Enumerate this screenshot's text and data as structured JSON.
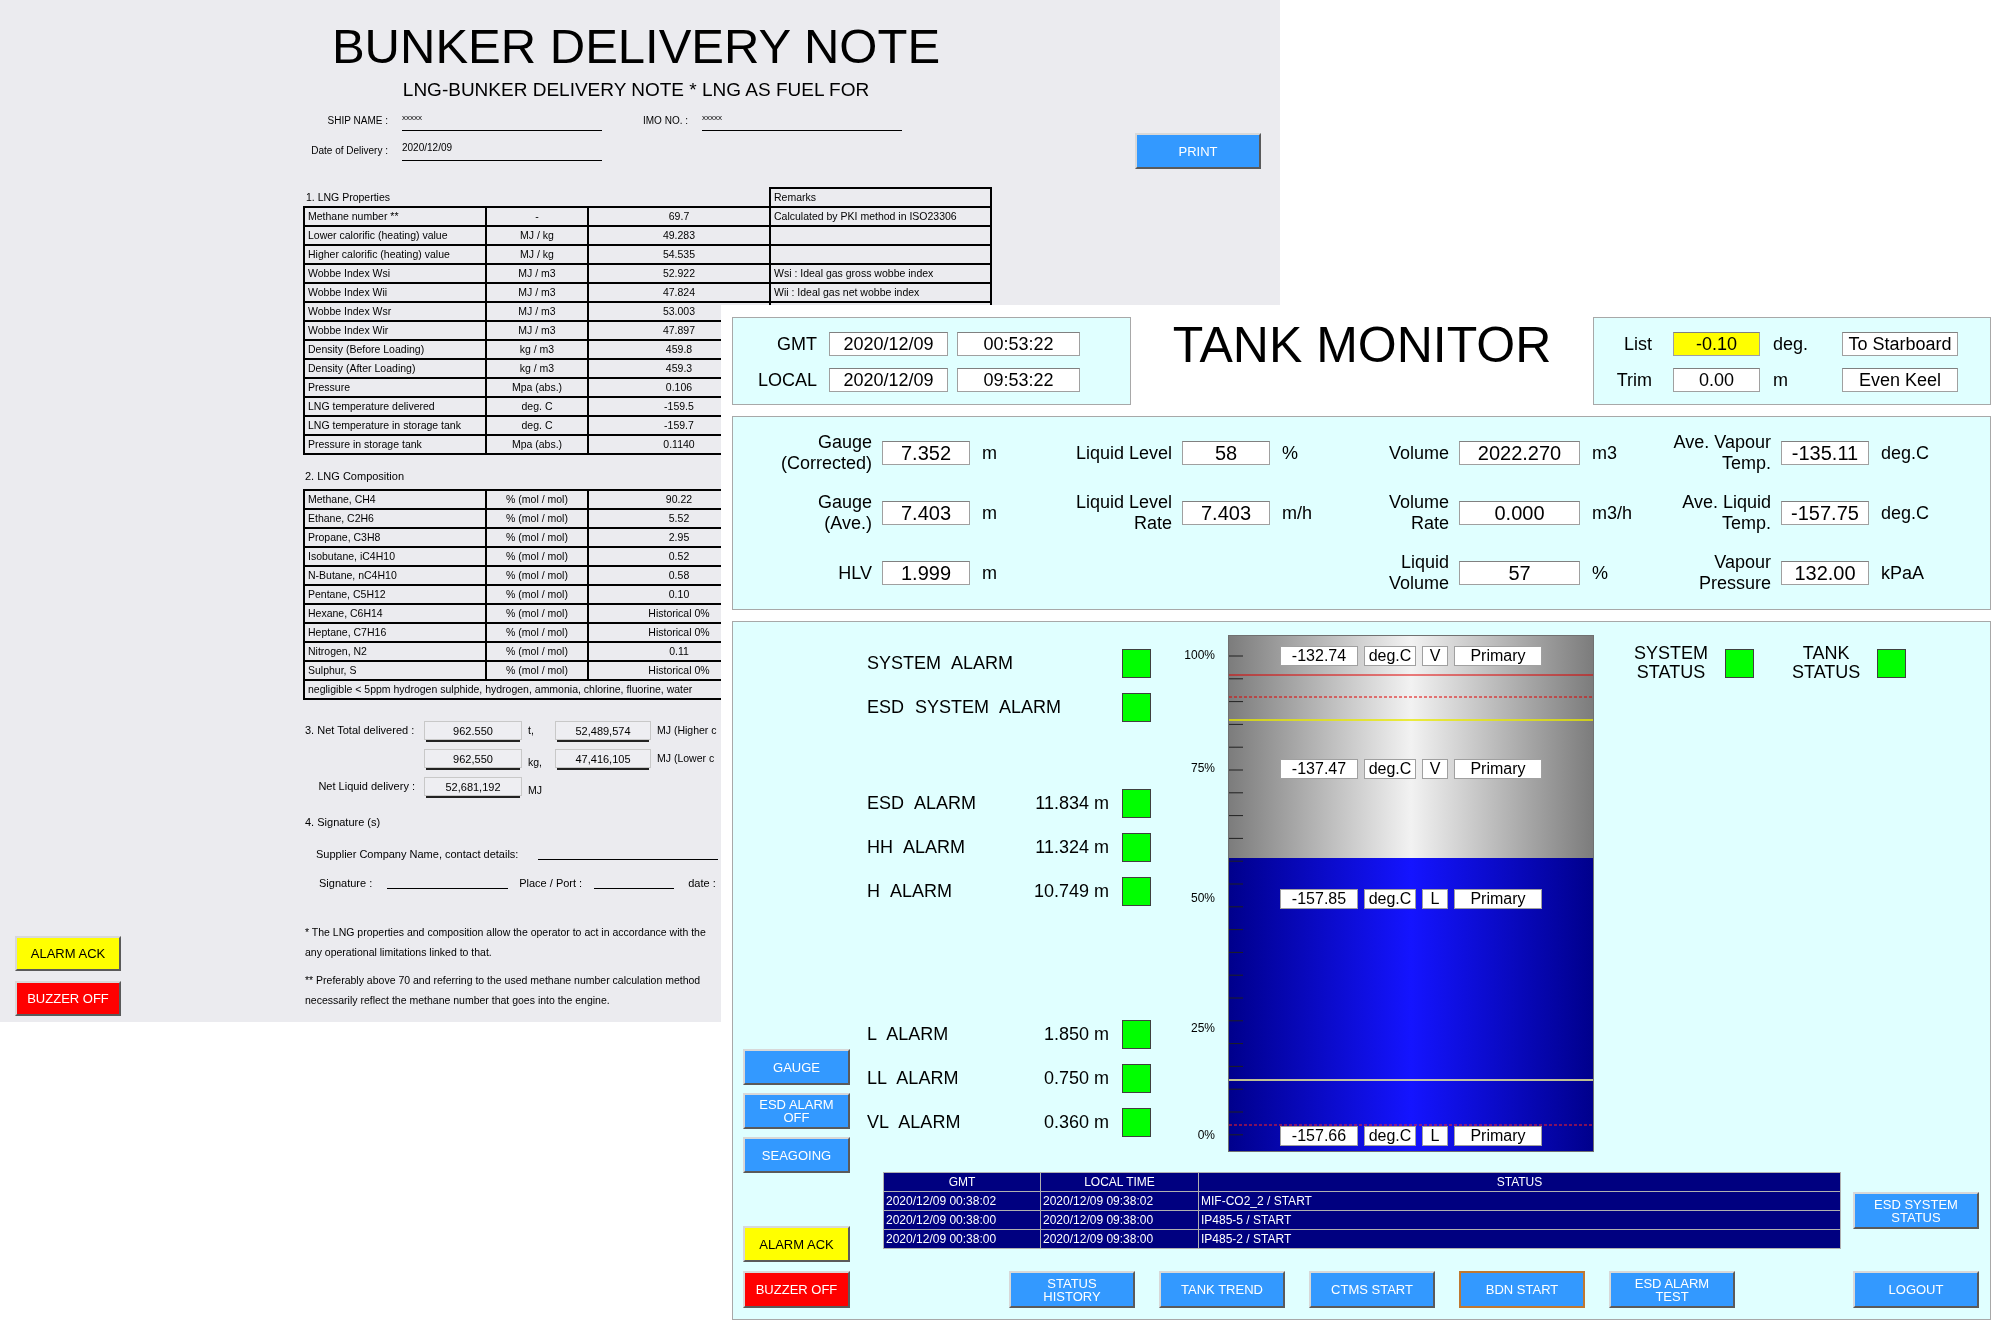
{
  "delivery_note": {
    "title": "BUNKER DELIVERY NOTE",
    "subtitle": "LNG-BUNKER DELIVERY NOTE * LNG AS FUEL FOR",
    "ship_name": {
      "label": "SHIP NAME :",
      "value": "xxxxx"
    },
    "imo_no": {
      "label": "IMO NO. :",
      "value": "xxxxx"
    },
    "date_of_delivery": {
      "label": "Date of Delivery :",
      "value": "2020/12/09"
    },
    "print_button": "PRINT",
    "properties": {
      "title": "1. LNG Properties",
      "remarks_header": "Remarks",
      "rows": [
        {
          "name": "Methane number **",
          "unit": "-",
          "value": "69.7",
          "remark": "Calculated by PKI method in ISO23306"
        },
        {
          "name": "Lower calorific (heating) value",
          "unit": "MJ / kg",
          "value": "49.283"
        },
        {
          "name": "Higher calorific (heating) value",
          "unit": "MJ / kg",
          "value": "54.535"
        },
        {
          "name": "Wobbe Index Wsi",
          "unit": "MJ / m3",
          "value": "52.922",
          "remark": "Wsi : Ideal gas gross wobbe index"
        },
        {
          "name": "Wobbe Index Wii",
          "unit": "MJ / m3",
          "value": "47.824",
          "remark": "Wii : Ideal gas net wobbe index"
        },
        {
          "name": "Wobbe Index Wsr",
          "unit": "MJ / m3",
          "value": "53.003"
        },
        {
          "name": "Wobbe Index Wir",
          "unit": "MJ / m3",
          "value": "47.897"
        },
        {
          "name": "Density (Before Loading)",
          "unit": "kg / m3",
          "value": "459.8"
        },
        {
          "name": "Density (After Loading)",
          "unit": "kg / m3",
          "value": "459.3"
        },
        {
          "name": "Pressure",
          "unit": "Mpa (abs.)",
          "value": "0.106"
        },
        {
          "name": "LNG temperature delivered",
          "unit": "deg. C",
          "value": "-159.5"
        },
        {
          "name": "LNG temperature in storage tank",
          "unit": "deg. C",
          "value": "-159.7"
        },
        {
          "name": "Pressure in storage tank",
          "unit": "Mpa (abs.)",
          "value": "0.1140"
        }
      ]
    },
    "composition": {
      "title": "2. LNG Composition",
      "rows": [
        {
          "name": "Methane, CH4",
          "unit": "% (mol / mol)",
          "value": "90.22"
        },
        {
          "name": "Ethane, C2H6",
          "unit": "% (mol / mol)",
          "value": "5.52"
        },
        {
          "name": "Propane, C3H8",
          "unit": "% (mol / mol)",
          "value": "2.95"
        },
        {
          "name": "Isobutane, iC4H10",
          "unit": "% (mol / mol)",
          "value": "0.52"
        },
        {
          "name": "N-Butane, nC4H10",
          "unit": "% (mol / mol)",
          "value": "0.58"
        },
        {
          "name": "Pentane, C5H12",
          "unit": "% (mol / mol)",
          "value": "0.10"
        },
        {
          "name": "Hexane, C6H14",
          "unit": "% (mol / mol)",
          "value": "Historical 0%"
        },
        {
          "name": "Heptane, C7H16",
          "unit": "% (mol / mol)",
          "value": "Historical 0%"
        },
        {
          "name": "Nitrogen, N2",
          "unit": "% (mol / mol)",
          "value": "0.11"
        },
        {
          "name": "Sulphur, S",
          "unit": "% (mol / mol)",
          "value": "Historical 0%"
        }
      ],
      "note": "negligible < 5ppm hydrogen sulphide, hydrogen, ammonia, chlorine, fluorine, water"
    },
    "net_total": {
      "label": "3. Net Total delivered :",
      "rows": [
        {
          "value": "962.550",
          "unit": "t,",
          "energy": "52,489,574",
          "energy_unit": "MJ (Higher c"
        },
        {
          "value": "962,550",
          "unit": "kg,",
          "energy": "47,416,105",
          "energy_unit": "MJ (Lower c"
        }
      ],
      "net_liquid": {
        "label": "Net Liquid delivery :",
        "value": "52,681,192",
        "unit": "MJ"
      }
    },
    "signatures": {
      "title": "4. Signature (s)",
      "supplier_label": "Supplier Company Name, contact details:",
      "signature_label": "Signature :",
      "place_label": "Place / Port :",
      "date_label": "date :"
    },
    "footnotes": [
      "* The LNG properties and composition allow the operator to act in accordance with the",
      "any operational limitations linked to that.",
      "** Preferably above 70 and referring to the used methane number calculation method",
      "necessarily reflect the methane number that goes into the engine."
    ],
    "buttons": [
      {
        "label": "ALARM ACK",
        "kind": "ack"
      },
      {
        "label": "BUZZER OFF",
        "kind": "buzzer"
      }
    ]
  },
  "tank_monitor": {
    "clock": [
      {
        "label": "GMT",
        "date": "2020/12/09",
        "time": "00:53:22"
      },
      {
        "label": "LOCAL",
        "date": "2020/12/09",
        "time": "09:53:22"
      }
    ],
    "title": "TANK MONITOR",
    "attitude": [
      {
        "label": "List",
        "value": "-0.10",
        "highlighted": true,
        "unit": "deg.",
        "status": "To Starboard"
      },
      {
        "label": "Trim",
        "value": "0.00",
        "highlighted": false,
        "unit": "m",
        "status": "Even Keel"
      }
    ],
    "readings": [
      [
        {
          "label": "Gauge\n(Corrected)",
          "value": "7.352",
          "unit": "m"
        },
        {
          "label": "Gauge\n(Ave.)",
          "value": "7.403",
          "unit": "m"
        },
        {
          "label": "HLV",
          "value": "1.999",
          "unit": "m"
        }
      ],
      [
        {
          "label": "Liquid Level",
          "value": "58",
          "unit": "%"
        },
        {
          "label": "Liquid Level\nRate",
          "value": "7.403",
          "unit": "m/h"
        }
      ],
      [
        {
          "label": "Volume",
          "value": "2022.270",
          "unit": "m3"
        },
        {
          "label": "Volume\nRate",
          "value": "0.000",
          "unit": "m3/h"
        },
        {
          "label": "Liquid\nVolume",
          "value": "57",
          "unit": "%"
        }
      ],
      [
        {
          "label": "Ave. Vapour\nTemp.",
          "value": "-135.11",
          "unit": "deg.C"
        },
        {
          "label": "Ave. Liquid\nTemp.",
          "value": "-157.75",
          "unit": "deg.C"
        },
        {
          "label": "Vapour\nPressure",
          "value": "132.00",
          "unit": "kPaA"
        }
      ]
    ],
    "alarm_groups": [
      [
        {
          "label": "SYSTEM ALARM",
          "color": "#00ff00"
        },
        {
          "label": "ESD SYSTEM ALARM",
          "color": "#00ff00"
        }
      ],
      [
        {
          "label": "ESD ALARM",
          "value": "11.834 m",
          "color": "#00ff00"
        },
        {
          "label": "HH ALARM",
          "value": "11.324 m",
          "color": "#00ff00"
        },
        {
          "label": "H ALARM",
          "value": "10.749 m",
          "color": "#00ff00"
        }
      ],
      [
        {
          "label": "L ALARM",
          "value": "1.850 m",
          "color": "#00ff00"
        },
        {
          "label": "LL ALARM",
          "value": "0.750 m",
          "color": "#00ff00"
        },
        {
          "label": "VL ALARM",
          "value": "0.360 m",
          "color": "#00ff00"
        }
      ]
    ],
    "mode_buttons": [
      "GAUGE",
      "ESD ALARM\nOFF",
      "SEAGOING"
    ],
    "tank": {
      "level": 0.58,
      "scale": [
        "100%",
        "75%",
        "50%",
        "25%",
        "0%"
      ],
      "probes": [
        {
          "temp": "-132.74",
          "unit": "deg.C",
          "phase": "V",
          "sensor": "Primary"
        },
        {
          "temp": "-137.47",
          "unit": "deg.C",
          "phase": "V",
          "sensor": "Primary"
        },
        {
          "temp": "-157.85",
          "unit": "deg.C",
          "phase": "L",
          "sensor": "Primary"
        },
        {
          "temp": "-157.66",
          "unit": "deg.C",
          "phase": "L",
          "sensor": "Primary"
        }
      ]
    },
    "status": [
      {
        "label": "SYSTEM\nSTATUS",
        "color": "#00ff00"
      },
      {
        "label": "TANK\nSTATUS",
        "color": "#00ff00"
      }
    ],
    "events": {
      "columns": [
        "GMT",
        "LOCAL TIME",
        "STATUS"
      ],
      "rows": [
        [
          "2020/12/09 00:38:02",
          "2020/12/09 09:38:02",
          "MIF-CO2_2 / START"
        ],
        [
          "2020/12/09 00:38:00",
          "2020/12/09 09:38:00",
          "IP485-5 / START"
        ],
        [
          "2020/12/09 00:38:00",
          "2020/12/09 09:38:00",
          "IP485-2 / START"
        ]
      ]
    },
    "alarm_buttons": [
      {
        "label": "ALARM ACK",
        "kind": "ack"
      },
      {
        "label": "BUZZER OFF",
        "kind": "buzzer"
      }
    ],
    "esd_status_button": "ESD SYSTEM\nSTATUS",
    "bottom_buttons": [
      {
        "label": "STATUS\nHISTORY",
        "focused": false
      },
      {
        "label": "TANK TREND",
        "focused": false
      },
      {
        "label": "CTMS START",
        "focused": false
      },
      {
        "label": "BDN START",
        "focused": true
      },
      {
        "label": "ESD ALARM\nTEST",
        "focused": false
      }
    ],
    "logout_button": "LOGOUT"
  }
}
